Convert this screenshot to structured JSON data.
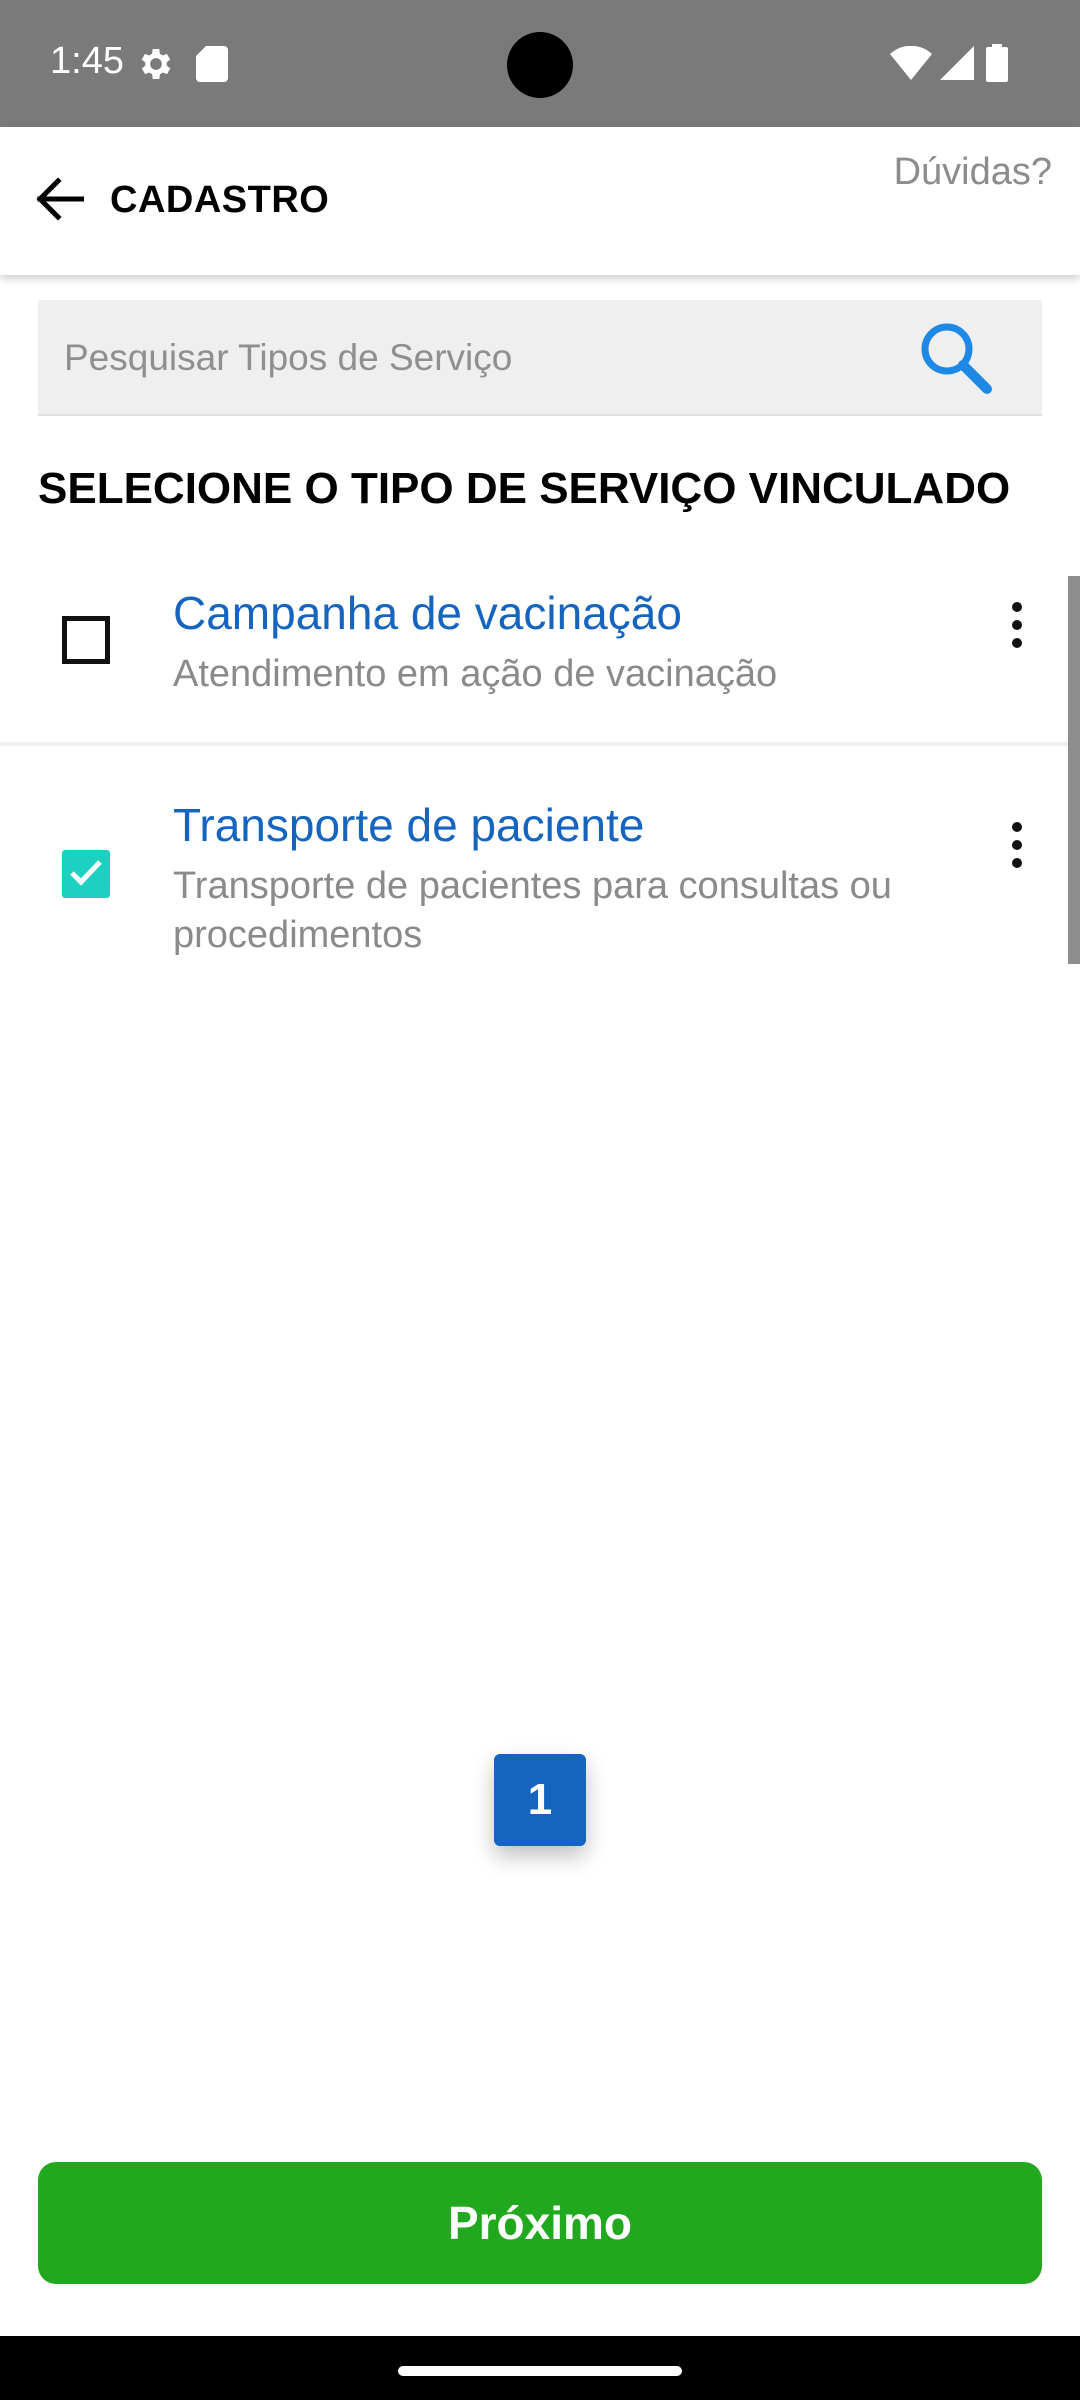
{
  "status_bar": {
    "time": "1:45"
  },
  "app_bar": {
    "title": "CADASTRO",
    "help_label": "Dúvidas?"
  },
  "search": {
    "placeholder": "Pesquisar Tipos de Serviço",
    "value": ""
  },
  "section_heading": "SELECIONE O TIPO DE SERVIÇO VINCULADO",
  "services": [
    {
      "title": "Campanha de vacinação",
      "description": "Atendimento em ação de vacinação",
      "checked": false
    },
    {
      "title": "Transporte de paciente",
      "description": "Transporte de pacientes para consultas ou procedimentos",
      "checked": true
    }
  ],
  "pagination": {
    "current_page": "1"
  },
  "footer": {
    "next_label": "Próximo"
  },
  "colors": {
    "accent_blue": "#1565c0",
    "checkbox_checked": "#1dd1c0",
    "next_button": "#22a81e",
    "status_bar": "#7a7a7a"
  },
  "icons": {
    "back": "arrow-left-icon",
    "search": "magnifier-icon",
    "menu": "more-vertical-icon",
    "check": "checkmark-icon"
  }
}
